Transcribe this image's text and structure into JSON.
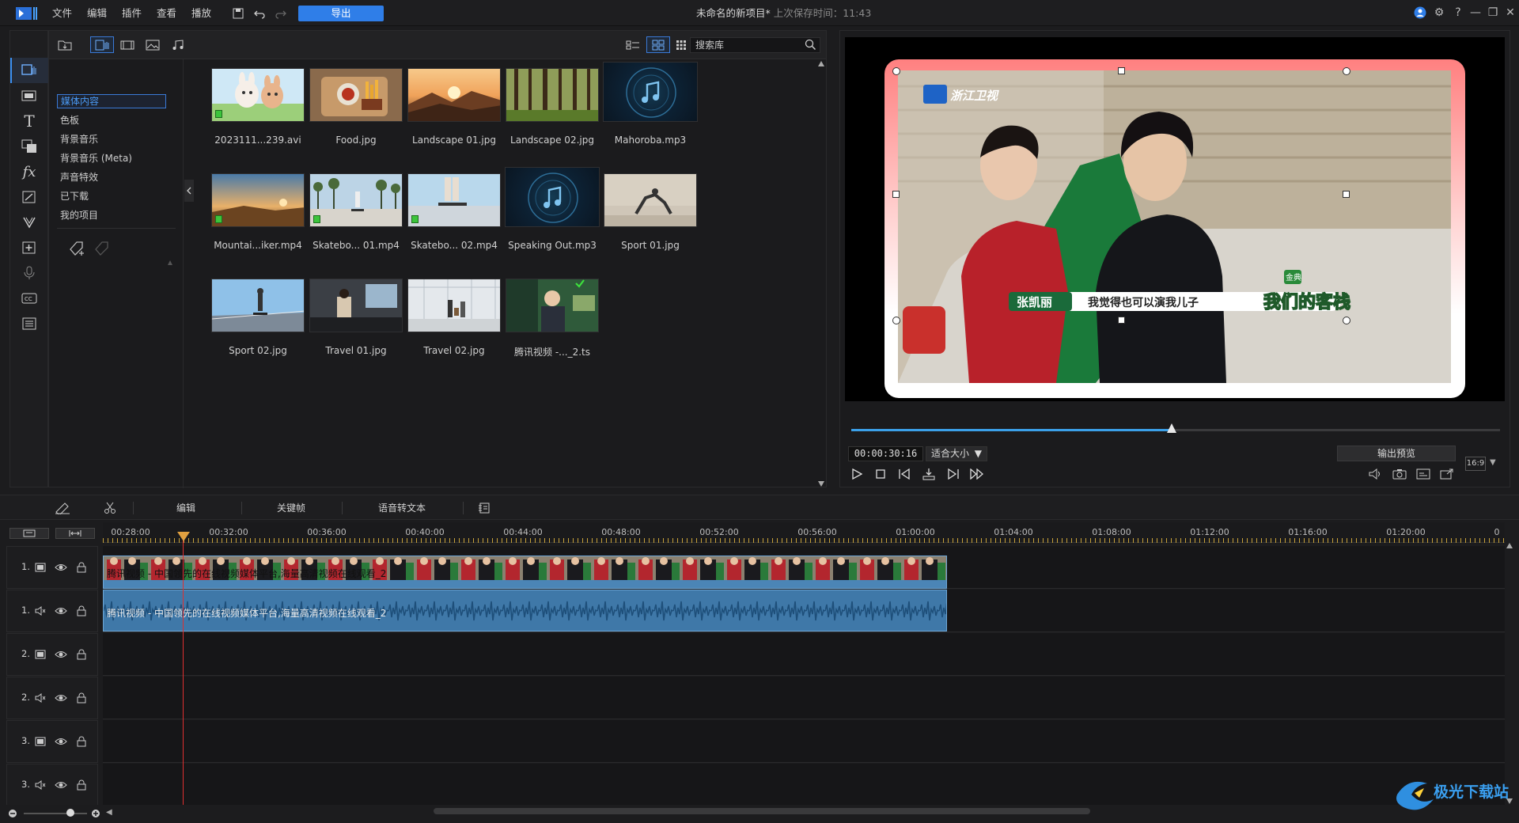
{
  "menu": [
    "文件",
    "编辑",
    "插件",
    "查看",
    "播放"
  ],
  "export_label": "导出",
  "project": {
    "title": "未命名的新项目*",
    "saved": "上次保存时间：11:43"
  },
  "library": {
    "search_placeholder": "搜索库",
    "categories": [
      "媒体内容",
      "色板",
      "背景音乐",
      "背景音乐 (Meta)",
      "声音特效",
      "已下载",
      "我的项目"
    ],
    "items": [
      {
        "name": "2023111...239.avi"
      },
      {
        "name": "Food.jpg"
      },
      {
        "name": "Landscape 01.jpg"
      },
      {
        "name": "Landscape 02.jpg"
      },
      {
        "name": "Mahoroba.mp3"
      },
      {
        "name": "Mountai...iker.mp4"
      },
      {
        "name": "Skatebo... 01.mp4"
      },
      {
        "name": "Skatebo... 02.mp4"
      },
      {
        "name": "Speaking Out.mp3"
      },
      {
        "name": "Sport 01.jpg"
      },
      {
        "name": "Sport 02.jpg"
      },
      {
        "name": "Travel 01.jpg"
      },
      {
        "name": "Travel 02.jpg"
      },
      {
        "name": "腾讯视频 -..._2.ts"
      }
    ]
  },
  "preview": {
    "timecode": "00:00:30:16",
    "fit": "适合大小",
    "output_preview": "输出预览",
    "aspect": "16:9",
    "scrub_progress": 0.494,
    "overlay": {
      "channel": "浙江卫视",
      "name": "张凯丽",
      "caption": "我觉得也可以演我儿子",
      "show": "我们的客栈",
      "show_tag": "金典"
    }
  },
  "timeline": {
    "tools": {
      "edit": "编辑",
      "keyframe": "关键帧",
      "speech_to_text": "语音转文本"
    },
    "ruler": [
      "00:28:00",
      "00:32:00",
      "00:36:00",
      "00:40:00",
      "00:44:00",
      "00:48:00",
      "00:52:00",
      "00:56:00",
      "01:00:00",
      "01:04:00",
      "01:08:00",
      "01:12:00",
      "01:16:00",
      "01:20:00",
      "0"
    ],
    "tracks": [
      "1.",
      "1.",
      "2.",
      "2.",
      "3.",
      "3."
    ],
    "clip_name": "腾讯视频 - 中国领先的在线视频媒体平台,海量高清视频在线观看_2"
  },
  "watermark": "极光下载站"
}
